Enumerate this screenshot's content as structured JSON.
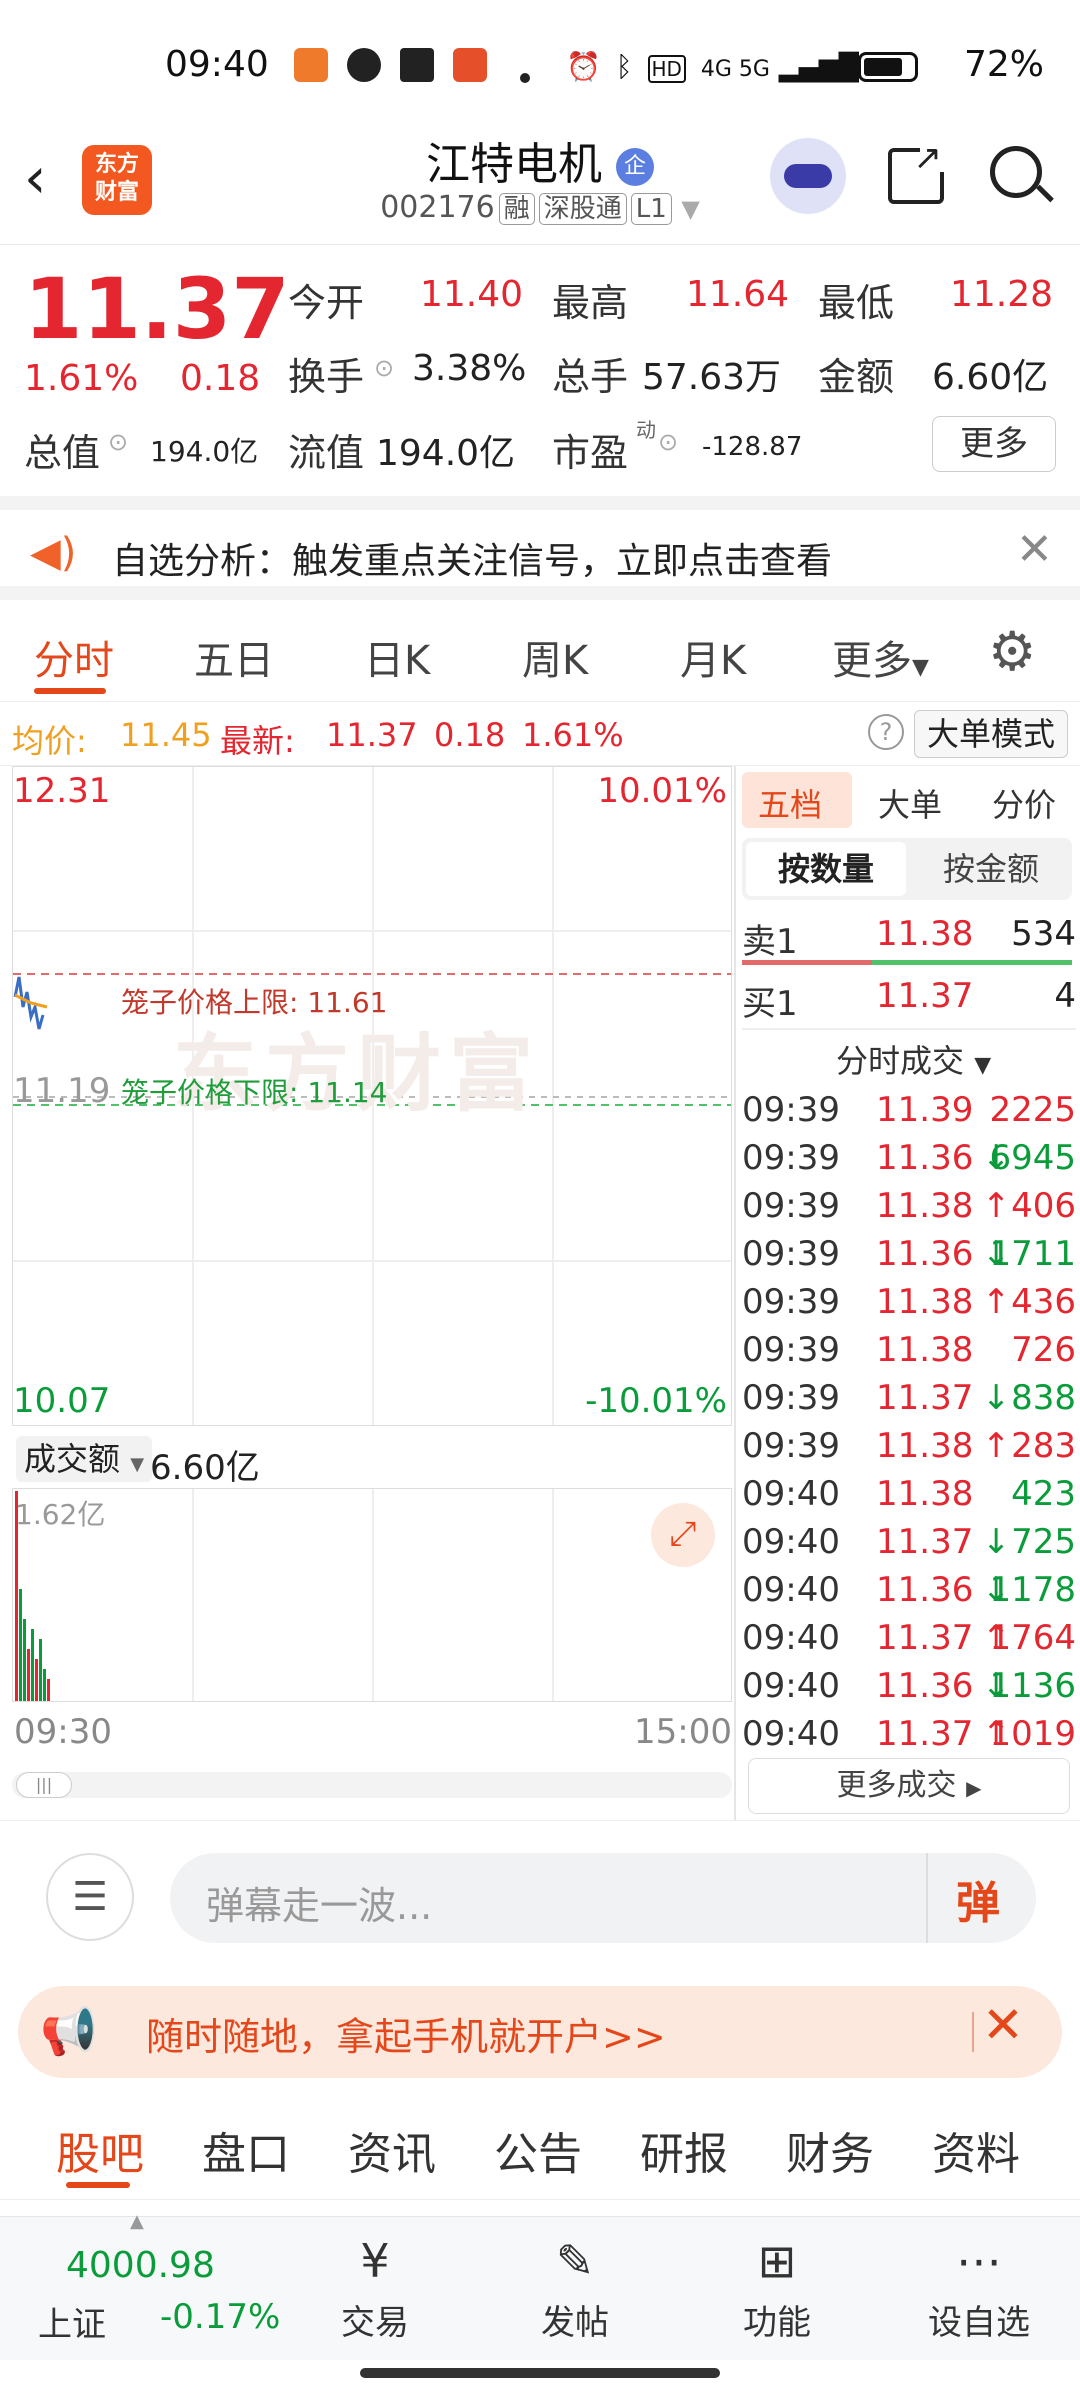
{
  "status": {
    "time": "09:40",
    "network": "4G 5G",
    "battery": "72%"
  },
  "header": {
    "logo_line1": "东方",
    "logo_line2": "财富",
    "name": "江特电机",
    "badge": "企",
    "code": "002176",
    "tags": [
      "融",
      "深股通",
      "L1"
    ]
  },
  "quote": {
    "price": "11.37",
    "change_pct": "1.61%",
    "change": "0.18",
    "open_label": "今开",
    "open": "11.40",
    "high_label": "最高",
    "high": "11.64",
    "low_label": "最低",
    "low": "11.28",
    "turnover_label": "换手",
    "turnover": "3.38%",
    "volume_label": "总手",
    "volume": "57.63万",
    "amount_label": "金额",
    "amount": "6.60亿",
    "mktcap_label": "总值",
    "mktcap": "194.0亿",
    "float_label": "流值",
    "float": "194.0亿",
    "pe_label": "市盈",
    "pe_sup": "动",
    "pe": "-128.87",
    "more": "更多"
  },
  "notice": {
    "text": "自选分析：触发重点关注信号，立即点击查看"
  },
  "chart_tabs": [
    "分时",
    "五日",
    "日K",
    "周K",
    "月K",
    "更多"
  ],
  "avgbar": {
    "avg_label": "均价:",
    "avg": "11.45",
    "last_label": "最新:",
    "last": "11.37",
    "chg": "0.18",
    "pct": "1.61%",
    "mode": "大单模式"
  },
  "chart": {
    "top_price": "12.31",
    "top_pct": "10.01%",
    "bottom_price": "10.07",
    "bottom_pct": "-10.01%",
    "pre_close": "11.19",
    "upper_label": "笼子价格上限: 11.61",
    "lower_label": "笼子价格下限: 11.14",
    "watermark": "东方财富",
    "vol_label": "成交额",
    "vol_total": "6.60亿",
    "vol_max": "1.62亿",
    "time_start": "09:30",
    "time_end": "15:00",
    "colors": {
      "up": "#e3262f",
      "down": "#0a9c3a",
      "line": "#3a6ec4",
      "avg": "#f0a020"
    }
  },
  "panel": {
    "tabs": [
      "五档",
      "大单",
      "分价"
    ],
    "sub_tabs": [
      "按数量",
      "按金额"
    ],
    "sell1": {
      "label": "卖1",
      "price": "11.38",
      "qty": "534"
    },
    "buy1": {
      "label": "买1",
      "price": "11.37",
      "qty": "4"
    },
    "ticks_title": "分时成交",
    "ticks": [
      {
        "t": "09:39",
        "p": "11.39",
        "a": "",
        "v": "2225",
        "c": "red"
      },
      {
        "t": "09:39",
        "p": "11.36",
        "a": "↓",
        "v": "6945",
        "c": "green"
      },
      {
        "t": "09:39",
        "p": "11.38",
        "a": "↑",
        "v": "406",
        "c": "red"
      },
      {
        "t": "09:39",
        "p": "11.36",
        "a": "↓",
        "v": "1711",
        "c": "green"
      },
      {
        "t": "09:39",
        "p": "11.38",
        "a": "↑",
        "v": "436",
        "c": "red"
      },
      {
        "t": "09:39",
        "p": "11.38",
        "a": "",
        "v": "726",
        "c": "red"
      },
      {
        "t": "09:39",
        "p": "11.37",
        "a": "↓",
        "v": "838",
        "c": "green"
      },
      {
        "t": "09:39",
        "p": "11.38",
        "a": "↑",
        "v": "283",
        "c": "red"
      },
      {
        "t": "09:40",
        "p": "11.38",
        "a": "",
        "v": "423",
        "c": "green"
      },
      {
        "t": "09:40",
        "p": "11.37",
        "a": "↓",
        "v": "725",
        "c": "green"
      },
      {
        "t": "09:40",
        "p": "11.36",
        "a": "↓",
        "v": "1178",
        "c": "green"
      },
      {
        "t": "09:40",
        "p": "11.37",
        "a": "↑",
        "v": "1764",
        "c": "red"
      },
      {
        "t": "09:40",
        "p": "11.36",
        "a": "↓",
        "v": "1136",
        "c": "green"
      },
      {
        "t": "09:40",
        "p": "11.37",
        "a": "↑",
        "v": "1019",
        "c": "red"
      }
    ],
    "more_ticks": "更多成交"
  },
  "danmu": {
    "placeholder": "弹幕走一波...",
    "btn": "弹"
  },
  "promo": {
    "text": "随时随地，拿起手机就开户>>"
  },
  "bottom_tabs": [
    "股吧",
    "盘口",
    "资讯",
    "公告",
    "研报",
    "财务",
    "资料"
  ],
  "index": {
    "value": "4000.98",
    "name": "上证",
    "chg": "-0.17%"
  },
  "nav": [
    "交易",
    "发帖",
    "功能",
    "设自选"
  ]
}
